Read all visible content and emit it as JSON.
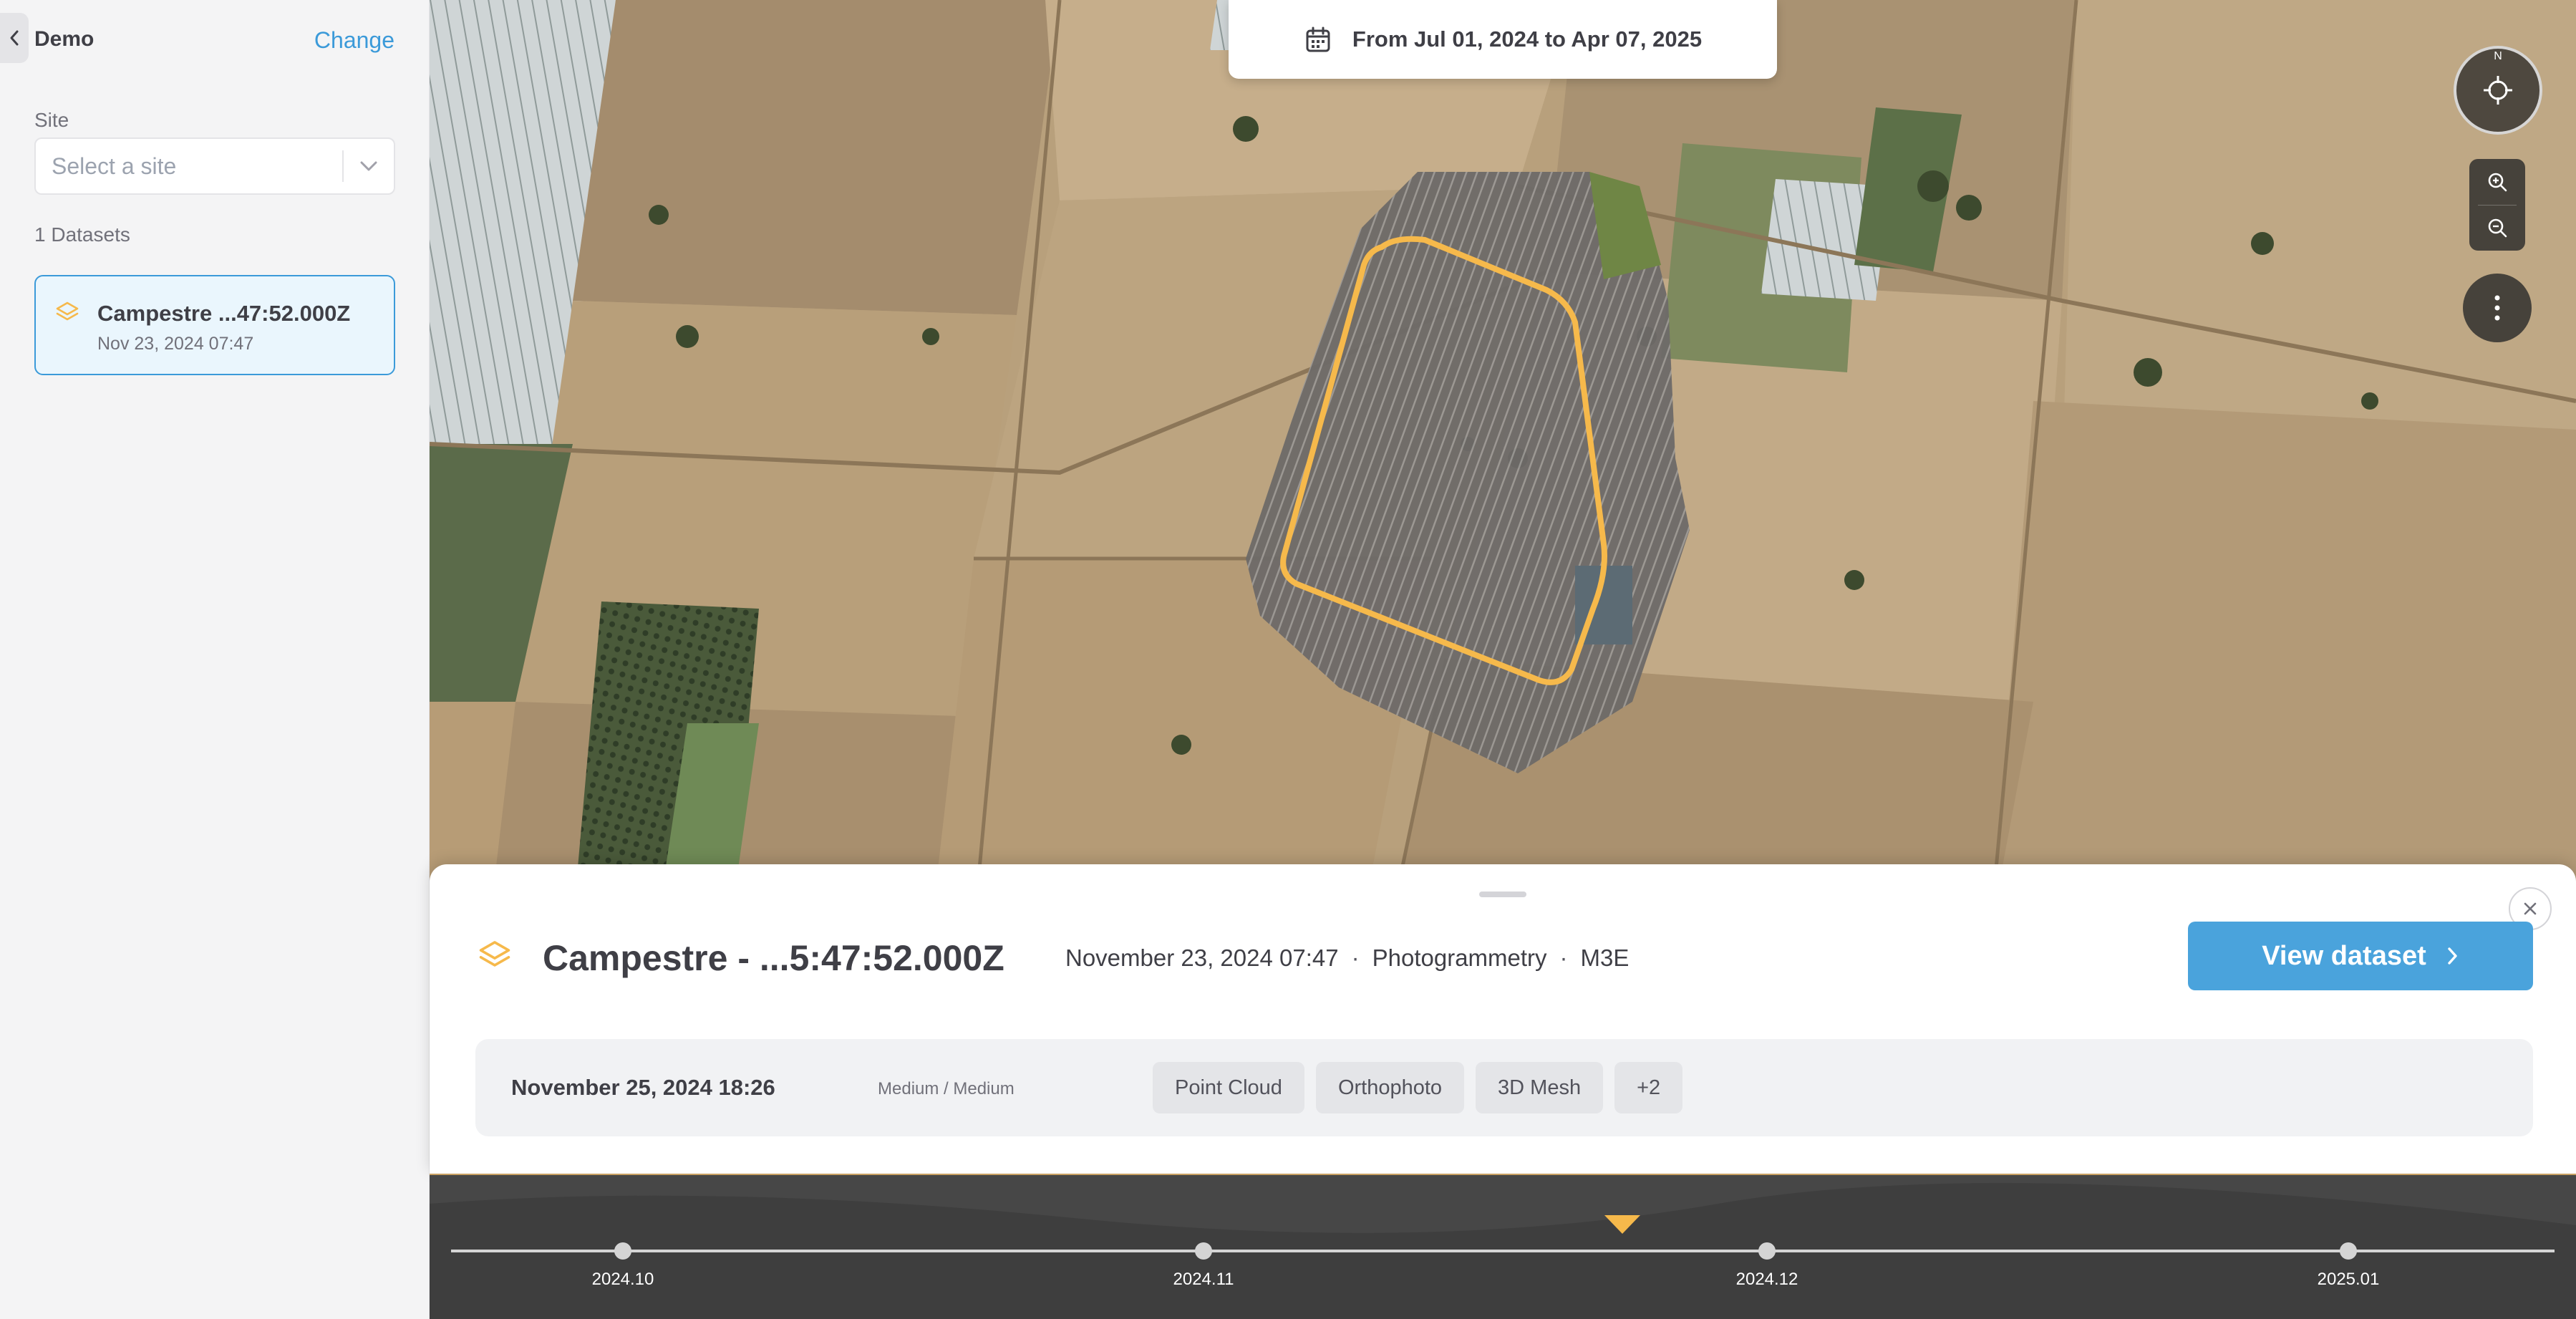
{
  "sidebar": {
    "project_name": "Demo",
    "change_label": "Change",
    "site_label": "Site",
    "site_placeholder": "Select a site",
    "dataset_count": "1 Datasets",
    "datasets": [
      {
        "name": "Campestre ...47:52.000Z",
        "date": "Nov 23, 2024 07:47"
      }
    ]
  },
  "map": {
    "date_range": "From Jul 01, 2024  to Apr 07, 2025",
    "compass_north": "N",
    "highlight_color": "#f6b94b"
  },
  "panel": {
    "title": "Campestre - ...5:47:52.000Z",
    "meta": [
      "November 23, 2024 07:47",
      "Photogrammetry",
      "M3E"
    ],
    "view_button": "View dataset",
    "processing": {
      "date": "November 25, 2024 18:26",
      "quality": "Medium / Medium",
      "outputs": [
        "Point Cloud",
        "Orthophoto",
        "3D Mesh",
        "+2"
      ]
    }
  },
  "timeline": {
    "ticks": [
      "2024.10",
      "2024.11",
      "2024.12",
      "2025.01"
    ]
  },
  "colors": {
    "accent": "#3b9ad9",
    "button": "#4aa3dc",
    "dataset_icon": "#f6b94b"
  }
}
